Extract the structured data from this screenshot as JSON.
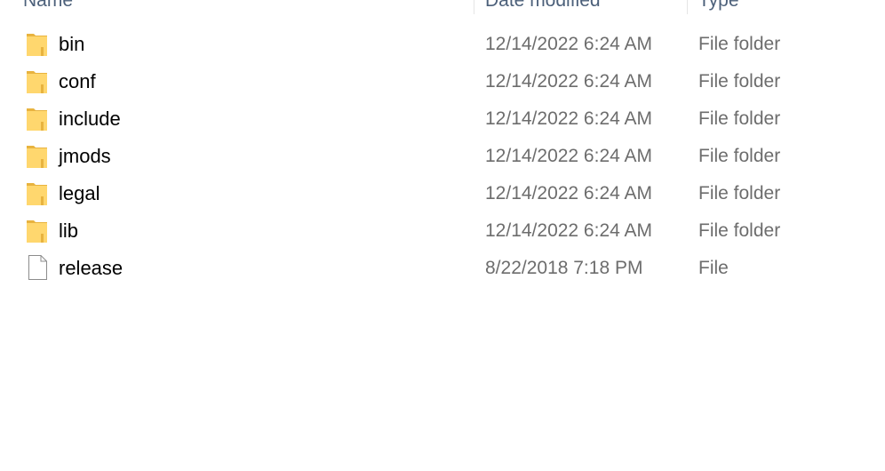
{
  "columns": {
    "name": "Name",
    "date_modified": "Date modified",
    "type": "Type"
  },
  "files": [
    {
      "name": "bin",
      "date": "12/14/2022 6:24 AM",
      "type": "File folder",
      "icon": "folder-icon"
    },
    {
      "name": "conf",
      "date": "12/14/2022 6:24 AM",
      "type": "File folder",
      "icon": "folder-icon"
    },
    {
      "name": "include",
      "date": "12/14/2022 6:24 AM",
      "type": "File folder",
      "icon": "folder-icon"
    },
    {
      "name": "jmods",
      "date": "12/14/2022 6:24 AM",
      "type": "File folder",
      "icon": "folder-icon"
    },
    {
      "name": "legal",
      "date": "12/14/2022 6:24 AM",
      "type": "File folder",
      "icon": "folder-icon"
    },
    {
      "name": "lib",
      "date": "12/14/2022 6:24 AM",
      "type": "File folder",
      "icon": "folder-icon"
    },
    {
      "name": "release",
      "date": "8/22/2018 7:18 PM",
      "type": "File",
      "icon": "file-icon"
    }
  ],
  "colors": {
    "folder_fill": "#ffd76e",
    "folder_dark": "#e8b33f",
    "date_text": "#6d6d6d",
    "header_text": "#4c607a"
  }
}
